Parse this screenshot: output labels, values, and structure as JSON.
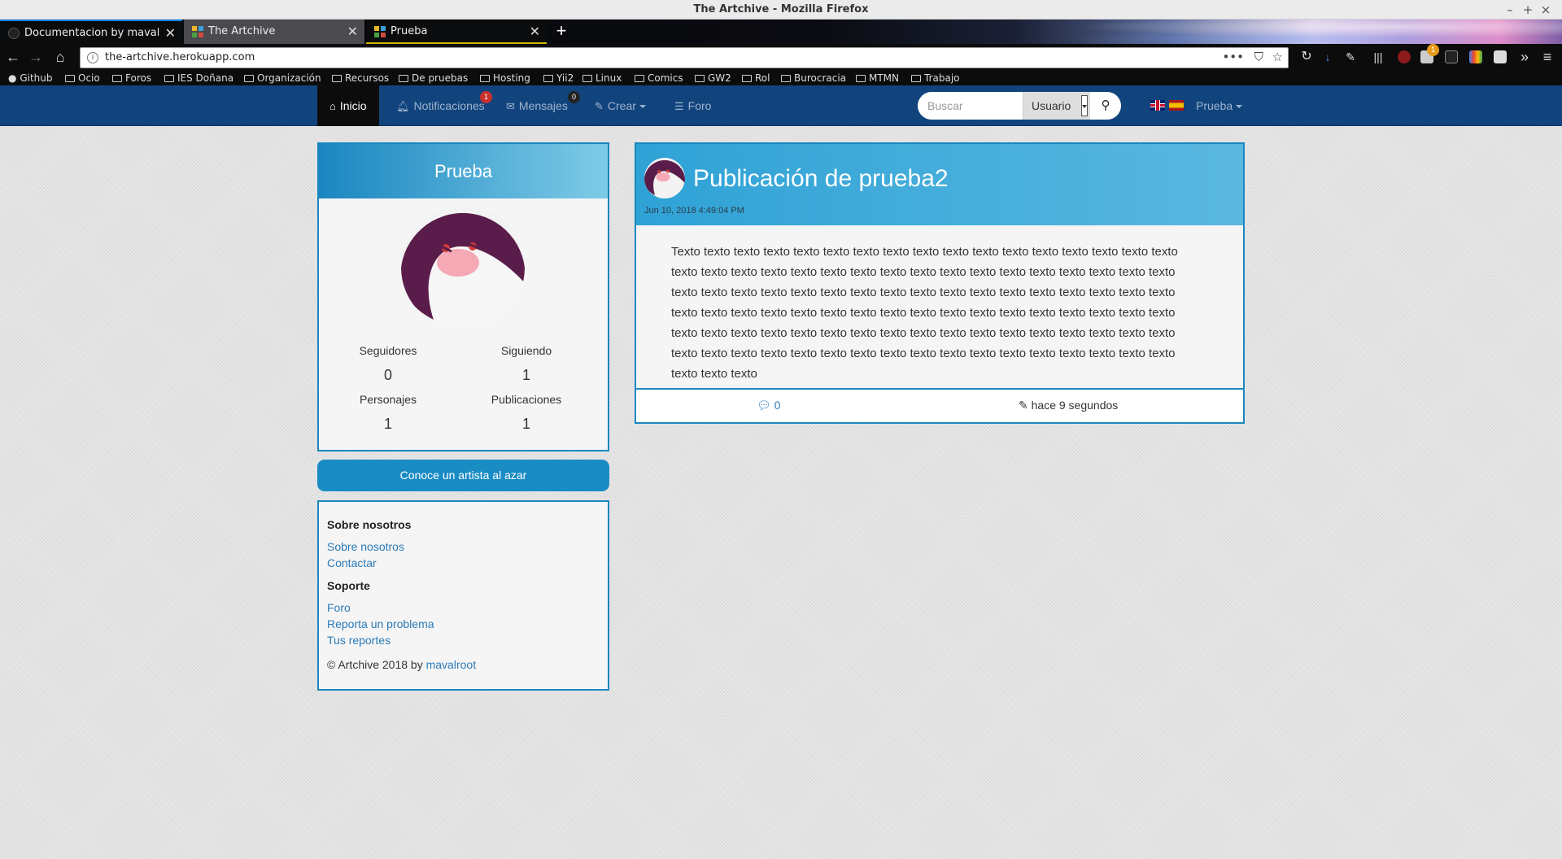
{
  "window": {
    "title": "The Artchive - Mozilla Firefox"
  },
  "tabs": [
    {
      "label": "Documentacion by mavalroot"
    },
    {
      "label": "The Artchive"
    },
    {
      "label": "Prueba"
    }
  ],
  "address": {
    "url": "the-artchive.herokuapp.com"
  },
  "bookmarks": [
    "Github",
    "Ocio",
    "Foros",
    "IES Doñana",
    "Organización",
    "Recursos",
    "De pruebas",
    "Hosting",
    "Yii2",
    "Linux",
    "Comics",
    "GW2",
    "Rol",
    "Burocracia",
    "MTMN",
    "Trabajo"
  ],
  "extensions": {
    "badge_count": "1"
  },
  "nav": {
    "home": "Inicio",
    "notifications": "Notificaciones",
    "notifications_badge": "1",
    "messages": "Mensajes",
    "messages_badge": "0",
    "create": "Crear",
    "forum": "Foro",
    "search_placeholder": "Buscar",
    "search_type": "Usuario",
    "user_menu": "Prueba"
  },
  "profile": {
    "name": "Prueba",
    "stats": [
      {
        "label": "Seguidores",
        "value": "0"
      },
      {
        "label": "Siguiendo",
        "value": "1"
      },
      {
        "label": "Personajes",
        "value": "1"
      },
      {
        "label": "Publicaciones",
        "value": "1"
      }
    ]
  },
  "random_artist_button": "Conoce un artista al azar",
  "footer": {
    "about_heading": "Sobre nosotros",
    "about_links": [
      "Sobre nosotros",
      "Contactar"
    ],
    "support_heading": "Soporte",
    "support_links": [
      "Foro",
      "Reporta un problema",
      "Tus reportes"
    ],
    "copyright": "© Artchive 2018 by",
    "author_link": "mavalroot"
  },
  "post": {
    "title": "Publicación de prueba2",
    "date": "Jun 10, 2018 4:49:04 PM",
    "body": "Texto texto texto texto texto texto texto texto texto texto texto texto texto texto texto texto texto texto texto texto texto texto texto texto texto texto texto texto texto texto texto texto texto texto texto texto texto texto texto texto texto texto texto texto texto texto texto texto texto texto texto texto texto texto texto texto texto texto texto texto texto texto texto texto texto texto texto texto texto texto texto texto texto texto texto texto texto texto texto texto texto texto texto texto texto texto texto texto texto texto texto texto texto texto texto texto texto texto texto texto texto texto texto texto texto",
    "comments_count": "0",
    "edited": "hace 9 segundos"
  },
  "colors": {
    "navbar": "#11447d",
    "accent": "#1c87bf",
    "avatar": "#5a1d4b"
  }
}
